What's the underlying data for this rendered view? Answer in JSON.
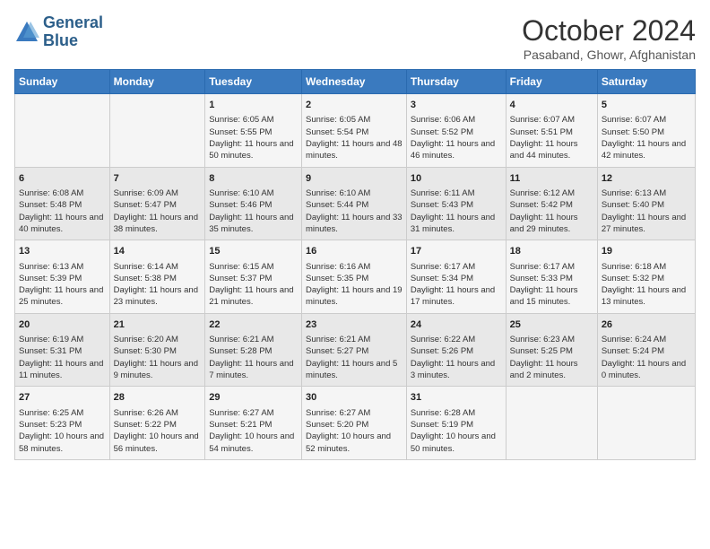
{
  "header": {
    "logo_line1": "General",
    "logo_line2": "Blue",
    "title": "October 2024",
    "subtitle": "Pasaband, Ghowr, Afghanistan"
  },
  "weekdays": [
    "Sunday",
    "Monday",
    "Tuesday",
    "Wednesday",
    "Thursday",
    "Friday",
    "Saturday"
  ],
  "weeks": [
    [
      {
        "day": "",
        "info": ""
      },
      {
        "day": "",
        "info": ""
      },
      {
        "day": "1",
        "info": "Sunrise: 6:05 AM\nSunset: 5:55 PM\nDaylight: 11 hours and 50 minutes."
      },
      {
        "day": "2",
        "info": "Sunrise: 6:05 AM\nSunset: 5:54 PM\nDaylight: 11 hours and 48 minutes."
      },
      {
        "day": "3",
        "info": "Sunrise: 6:06 AM\nSunset: 5:52 PM\nDaylight: 11 hours and 46 minutes."
      },
      {
        "day": "4",
        "info": "Sunrise: 6:07 AM\nSunset: 5:51 PM\nDaylight: 11 hours and 44 minutes."
      },
      {
        "day": "5",
        "info": "Sunrise: 6:07 AM\nSunset: 5:50 PM\nDaylight: 11 hours and 42 minutes."
      }
    ],
    [
      {
        "day": "6",
        "info": "Sunrise: 6:08 AM\nSunset: 5:48 PM\nDaylight: 11 hours and 40 minutes."
      },
      {
        "day": "7",
        "info": "Sunrise: 6:09 AM\nSunset: 5:47 PM\nDaylight: 11 hours and 38 minutes."
      },
      {
        "day": "8",
        "info": "Sunrise: 6:10 AM\nSunset: 5:46 PM\nDaylight: 11 hours and 35 minutes."
      },
      {
        "day": "9",
        "info": "Sunrise: 6:10 AM\nSunset: 5:44 PM\nDaylight: 11 hours and 33 minutes."
      },
      {
        "day": "10",
        "info": "Sunrise: 6:11 AM\nSunset: 5:43 PM\nDaylight: 11 hours and 31 minutes."
      },
      {
        "day": "11",
        "info": "Sunrise: 6:12 AM\nSunset: 5:42 PM\nDaylight: 11 hours and 29 minutes."
      },
      {
        "day": "12",
        "info": "Sunrise: 6:13 AM\nSunset: 5:40 PM\nDaylight: 11 hours and 27 minutes."
      }
    ],
    [
      {
        "day": "13",
        "info": "Sunrise: 6:13 AM\nSunset: 5:39 PM\nDaylight: 11 hours and 25 minutes."
      },
      {
        "day": "14",
        "info": "Sunrise: 6:14 AM\nSunset: 5:38 PM\nDaylight: 11 hours and 23 minutes."
      },
      {
        "day": "15",
        "info": "Sunrise: 6:15 AM\nSunset: 5:37 PM\nDaylight: 11 hours and 21 minutes."
      },
      {
        "day": "16",
        "info": "Sunrise: 6:16 AM\nSunset: 5:35 PM\nDaylight: 11 hours and 19 minutes."
      },
      {
        "day": "17",
        "info": "Sunrise: 6:17 AM\nSunset: 5:34 PM\nDaylight: 11 hours and 17 minutes."
      },
      {
        "day": "18",
        "info": "Sunrise: 6:17 AM\nSunset: 5:33 PM\nDaylight: 11 hours and 15 minutes."
      },
      {
        "day": "19",
        "info": "Sunrise: 6:18 AM\nSunset: 5:32 PM\nDaylight: 11 hours and 13 minutes."
      }
    ],
    [
      {
        "day": "20",
        "info": "Sunrise: 6:19 AM\nSunset: 5:31 PM\nDaylight: 11 hours and 11 minutes."
      },
      {
        "day": "21",
        "info": "Sunrise: 6:20 AM\nSunset: 5:30 PM\nDaylight: 11 hours and 9 minutes."
      },
      {
        "day": "22",
        "info": "Sunrise: 6:21 AM\nSunset: 5:28 PM\nDaylight: 11 hours and 7 minutes."
      },
      {
        "day": "23",
        "info": "Sunrise: 6:21 AM\nSunset: 5:27 PM\nDaylight: 11 hours and 5 minutes."
      },
      {
        "day": "24",
        "info": "Sunrise: 6:22 AM\nSunset: 5:26 PM\nDaylight: 11 hours and 3 minutes."
      },
      {
        "day": "25",
        "info": "Sunrise: 6:23 AM\nSunset: 5:25 PM\nDaylight: 11 hours and 2 minutes."
      },
      {
        "day": "26",
        "info": "Sunrise: 6:24 AM\nSunset: 5:24 PM\nDaylight: 11 hours and 0 minutes."
      }
    ],
    [
      {
        "day": "27",
        "info": "Sunrise: 6:25 AM\nSunset: 5:23 PM\nDaylight: 10 hours and 58 minutes."
      },
      {
        "day": "28",
        "info": "Sunrise: 6:26 AM\nSunset: 5:22 PM\nDaylight: 10 hours and 56 minutes."
      },
      {
        "day": "29",
        "info": "Sunrise: 6:27 AM\nSunset: 5:21 PM\nDaylight: 10 hours and 54 minutes."
      },
      {
        "day": "30",
        "info": "Sunrise: 6:27 AM\nSunset: 5:20 PM\nDaylight: 10 hours and 52 minutes."
      },
      {
        "day": "31",
        "info": "Sunrise: 6:28 AM\nSunset: 5:19 PM\nDaylight: 10 hours and 50 minutes."
      },
      {
        "day": "",
        "info": ""
      },
      {
        "day": "",
        "info": ""
      }
    ]
  ]
}
